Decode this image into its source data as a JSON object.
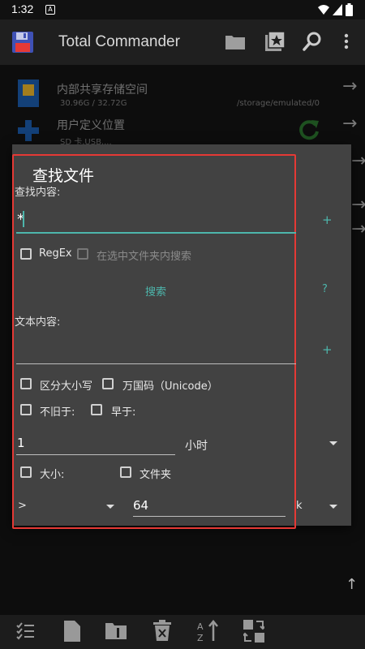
{
  "status_bar": {
    "time": "1:32",
    "notification_badge": "A"
  },
  "app_bar": {
    "title": "Total Commander",
    "icons": [
      "floppy-disk-icon",
      "folder-icon",
      "bookmark-icon",
      "search-icon",
      "more-vert-icon"
    ]
  },
  "storage_list": [
    {
      "title": "内部共享存储空间",
      "size": "30.96G / 32.72G",
      "path": "/storage/emulated/0"
    },
    {
      "title": "用户定义位置",
      "subtitle": "SD 卡,USB,..."
    }
  ],
  "dialog": {
    "title": "查找文件",
    "search_label": "查找内容:",
    "search_value": "*",
    "regex_label": "RegEx",
    "search_in_selected_label": "在选中文件夹内搜索",
    "search_button": "搜索",
    "help_button": "?",
    "plus": "+",
    "text_content_label": "文本内容:",
    "text_content_value": "",
    "case_sensitive_label": "区分大小写",
    "unicode_label": "万国码（Unicode）",
    "not_older_label": "不旧于:",
    "older_label": "早于:",
    "age_value": "1",
    "age_unit": "小时",
    "size_label": "大小:",
    "folder_label": "文件夹",
    "size_operator": ">",
    "size_value": "64",
    "size_unit_fragment": "k"
  },
  "colors": {
    "accent": "#4db6ac",
    "highlight_frame": "#e53935",
    "dialog_bg": "#424242"
  }
}
